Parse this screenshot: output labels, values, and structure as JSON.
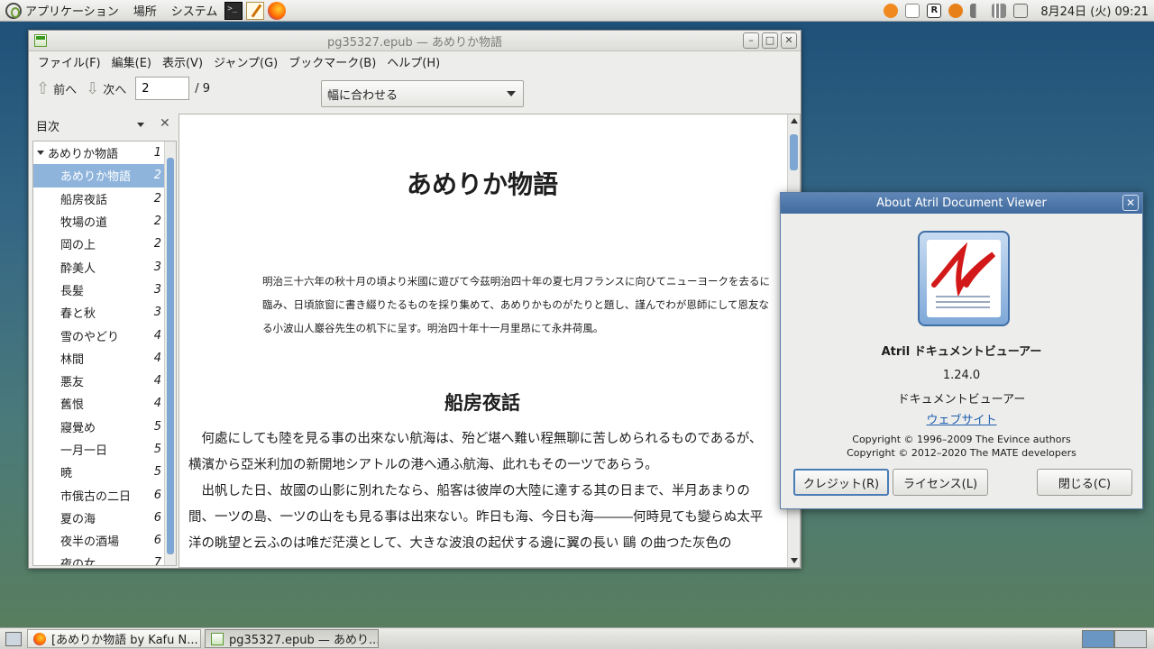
{
  "top_panel": {
    "menus": [
      "アプリケーション",
      "場所",
      "システム"
    ],
    "clock": "8月24日 (火) 09:21",
    "tray_icons": [
      "update-icon",
      "keyboard-icon",
      "r-icon",
      "gear-icon",
      "volume-icon",
      "network-icon",
      "battery-icon"
    ]
  },
  "main_window": {
    "title": "pg35327.epub — あめりか物語",
    "menu": [
      "ファイル(F)",
      "編集(E)",
      "表示(V)",
      "ジャンプ(G)",
      "ブックマーク(B)",
      "ヘルプ(H)"
    ],
    "toolbar": {
      "prev_label": "前へ",
      "next_label": "次へ",
      "page_value": "2",
      "page_total": "/ 9",
      "zoom": "幅に合わせる"
    },
    "sidebar": {
      "header": "目次",
      "items": [
        {
          "title": "あめりか物語",
          "page": "1"
        },
        {
          "title": "あめりか物語",
          "page": "2"
        },
        {
          "title": "船房夜話",
          "page": "2"
        },
        {
          "title": "牧場の道",
          "page": "2"
        },
        {
          "title": "岡の上",
          "page": "2"
        },
        {
          "title": "酔美人",
          "page": "3"
        },
        {
          "title": "長髪",
          "page": "3"
        },
        {
          "title": "春と秋",
          "page": "3"
        },
        {
          "title": "雪のやどり",
          "page": "4"
        },
        {
          "title": "林間",
          "page": "4"
        },
        {
          "title": "悪友",
          "page": "4"
        },
        {
          "title": "舊恨",
          "page": "4"
        },
        {
          "title": "寢覺め",
          "page": "5"
        },
        {
          "title": "一月一日",
          "page": "5"
        },
        {
          "title": "暁",
          "page": "5"
        },
        {
          "title": "市俄古の二日",
          "page": "6"
        },
        {
          "title": "夏の海",
          "page": "6"
        },
        {
          "title": "夜半の酒場",
          "page": "6"
        },
        {
          "title": "夜の女",
          "page": "7"
        }
      ]
    },
    "document": {
      "title": "あめりか物語",
      "preface": "明治三十六年の秋十月の頃より米國に遊びて今茲明治四十年の夏七月フランスに向ひてニューヨークを去るに臨み、日頃旅窗に書き綴りたるものを採り集めて、あめりかものがたりと題し、謹んでわが恩師にして恩友なる小波山人巖谷先生の机下に呈す。明治四十年十一月里昂にて永井荷風。",
      "chapter": "船房夜話",
      "paragraphs": [
        "何處にしても陸を見る事の出來ない航海は、殆ど堪へ難い程無聊に苦しめられるものであるが、横濱から亞米利加の新開地シアトルの港へ通ふ航海、此れもその一ツであらう。",
        "出帆した日、故國の山影に別れたなら、船客は彼岸の大陸に達する其の日まで、半月あまりの間、一ツの島、一ツの山をも見る事は出來ない。昨日も海、今日も海―――何時見ても變らぬ太平洋の眺望と云ふのは唯だ茫漠として、大きな波浪の起伏する邊に翼の長い 鷗 の曲つた灰色の"
      ]
    }
  },
  "about_dialog": {
    "title": "About Atril Document Viewer",
    "name": "Atril ドキュメントビューアー",
    "version": "1.24.0",
    "description": "ドキュメントビューアー",
    "website": "ウェブサイト",
    "copyright_1": "Copyright © 1996–2009 The Evince authors",
    "copyright_2": "Copyright © 2012–2020 The MATE developers",
    "credits_button": "クレジット(R)",
    "license_button": "ライセンス(L)",
    "close_button": "閉じる(C)"
  },
  "taskbar": {
    "tasks": [
      {
        "label": "[あめりか物語 by Kafu N..."
      },
      {
        "label": "pg35327.epub — あめり..."
      }
    ]
  },
  "colors": {
    "selection": "#8fb4dc",
    "dialog_titlebar": "#4c77aa",
    "link": "#1f5fb0",
    "logo_red": "#d21818"
  }
}
